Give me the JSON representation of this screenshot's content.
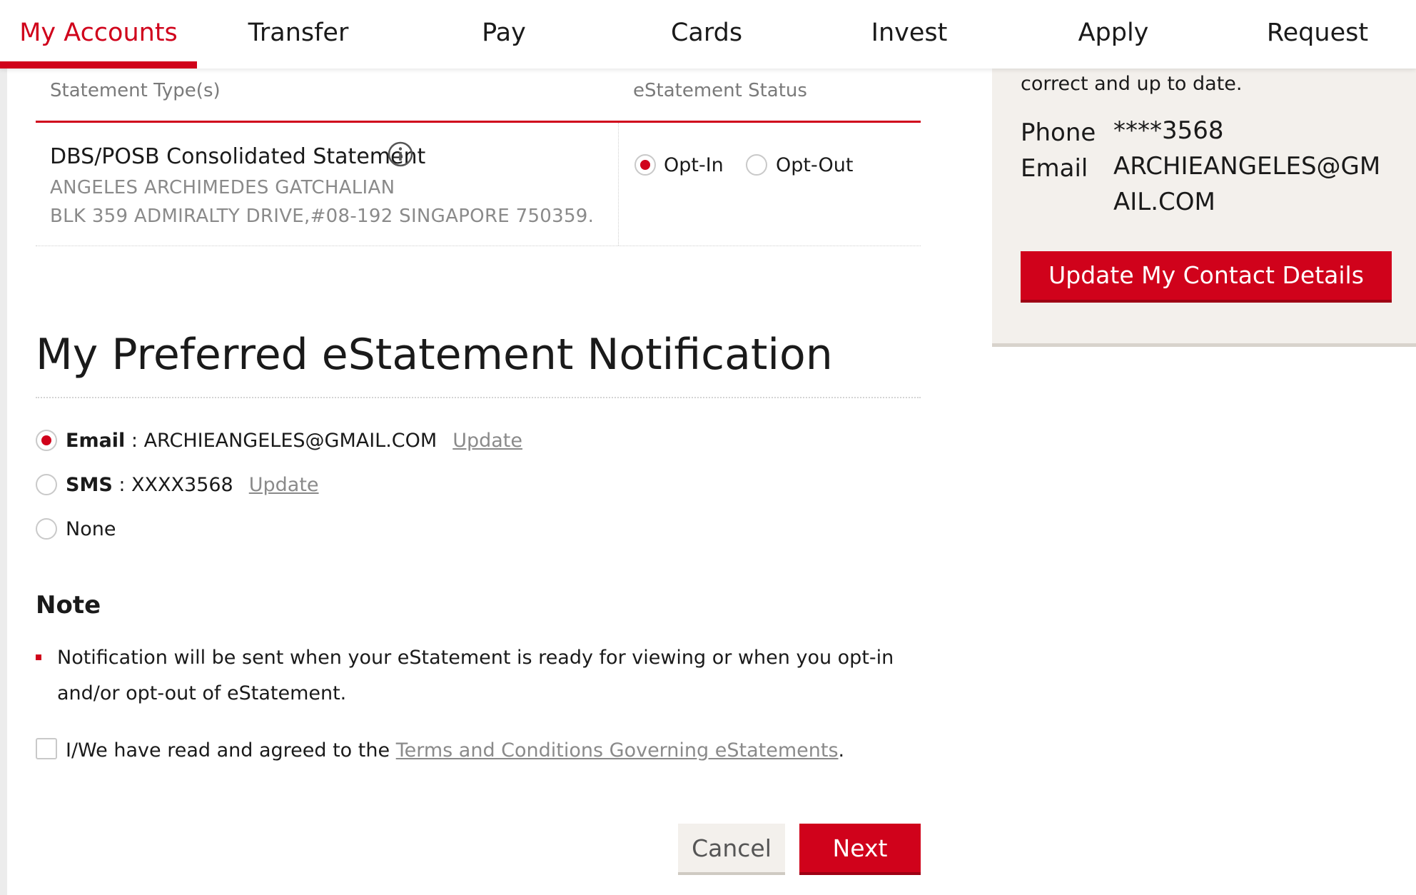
{
  "nav": {
    "tabs": [
      {
        "label": "My Accounts",
        "active": true
      },
      {
        "label": "Transfer",
        "active": false
      },
      {
        "label": "Pay",
        "active": false
      },
      {
        "label": "Cards",
        "active": false
      },
      {
        "label": "Invest",
        "active": false
      },
      {
        "label": "Apply",
        "active": false
      },
      {
        "label": "Request",
        "active": false
      }
    ]
  },
  "contact_panel": {
    "intro_text": "correct and up to date.",
    "phone_label": "Phone",
    "phone_value": "****3568",
    "email_label": "Email",
    "email_value_line1": "ARCHIEANGELES@GM",
    "email_value_line2": "AIL.COM",
    "update_button": "Update My Contact Details"
  },
  "statement_table": {
    "header_type": "Statement Type(s)",
    "header_status": "eStatement Status",
    "statement_name": "DBS/POSB Consolidated Statement",
    "holder_name": "ANGELES ARCHIMEDES GATCHALIAN",
    "address": "BLK 359 ADMIRALTY DRIVE,#08-192 SINGAPORE 750359.",
    "opt_in_label": "Opt-In",
    "opt_out_label": "Opt-Out",
    "selected_status": "Opt-In"
  },
  "notification": {
    "title": "My Preferred eStatement Notification",
    "options": [
      {
        "label": "Email",
        "separator": " : ",
        "value": "ARCHIEANGELES@GMAIL.COM",
        "link": "Update",
        "selected": true
      },
      {
        "label": "SMS",
        "separator": " : ",
        "value": "XXXX3568",
        "link": "Update",
        "selected": false
      },
      {
        "label": "None",
        "selected": false
      }
    ]
  },
  "note": {
    "title": "Note",
    "text": "Notification will be sent when your eStatement is ready for viewing or when you opt-in and/or opt-out of eStatement."
  },
  "agreement": {
    "prefix": "I/We have read and agreed to the ",
    "link": "Terms and Conditions Governing eStatements",
    "suffix": ".",
    "checked": false
  },
  "actions": {
    "cancel": "Cancel",
    "next": "Next"
  },
  "colors": {
    "brand_red": "#d0021b",
    "panel_beige": "#f3f0ec"
  }
}
